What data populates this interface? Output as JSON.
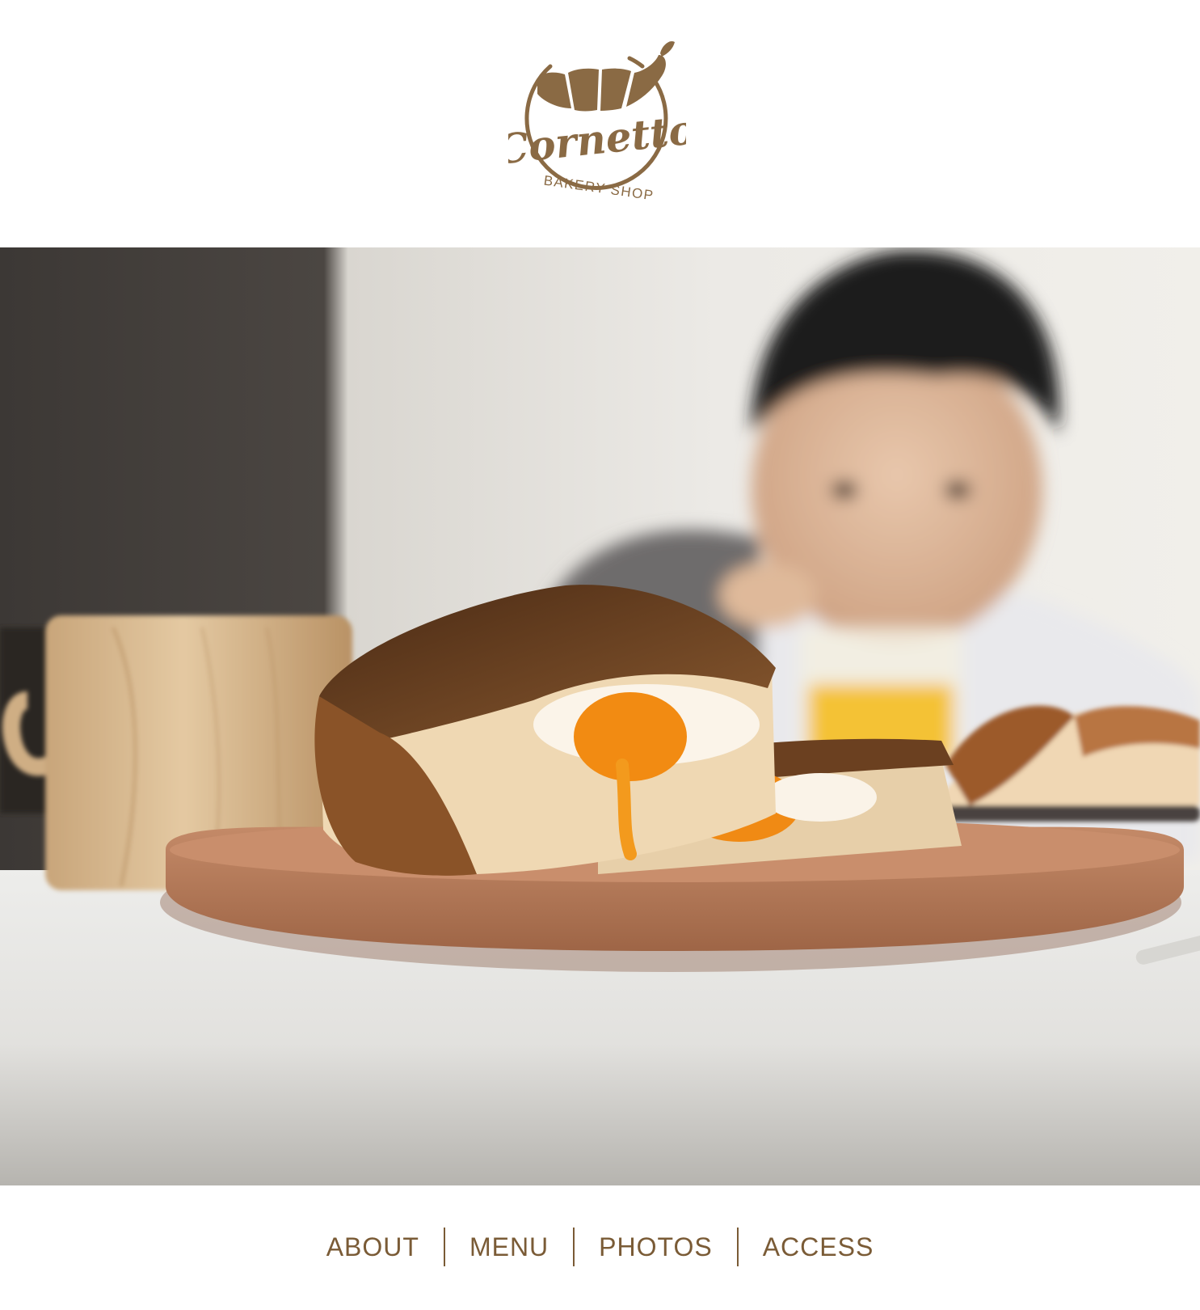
{
  "brand": {
    "name": "Cornetto",
    "tagline": "BAKERY SHOP",
    "color": "#8a6a44",
    "logo_icon": "croissant-icon"
  },
  "hero": {
    "image_alt": "Egg toast on a wooden plate with a child in the background"
  },
  "nav": {
    "color": "#7a5b36",
    "items": [
      {
        "label": "ABOUT"
      },
      {
        "label": "MENU"
      },
      {
        "label": "PHOTOS"
      },
      {
        "label": "ACCESS"
      }
    ]
  }
}
